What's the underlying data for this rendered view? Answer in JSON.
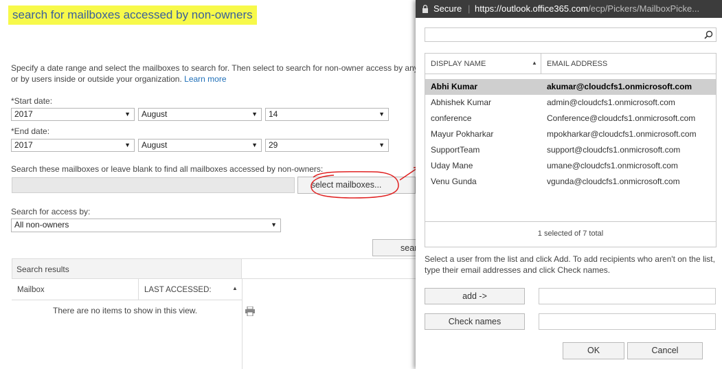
{
  "main": {
    "title": "search for mailboxes accessed by non-owners",
    "instructions_line1": "Specify a date range and select the mailboxes to search for. Then select to search for non-owner access by anyo",
    "instructions_line2": "or by users inside or outside your organization.",
    "learn_more": "Learn more",
    "start_date_label": "*Start date:",
    "start_year": "2017",
    "start_month": "August",
    "start_day": "14",
    "end_date_label": "*End date:",
    "end_year": "2017",
    "end_month": "August",
    "end_day": "29",
    "mailboxes_label": "Search these mailboxes or leave blank to find all mailboxes accessed by non-owners:",
    "select_mailboxes_button": "select mailboxes...",
    "access_by_label": "Search for access by:",
    "access_by_value": "All non-owners",
    "search_button_partial": "sear",
    "results_header": "Search results",
    "col_mailbox": "Mailbox",
    "col_last_accessed": "LAST ACCESSED:",
    "no_items": "There are no items to show in this view."
  },
  "popup": {
    "secure_label": "Secure",
    "url_host": "https://outlook.office365.com",
    "url_path": "/ecp/Pickers/MailboxPicke...",
    "search_placeholder": "",
    "col_display_name": "DISPLAY NAME",
    "col_email": "EMAIL ADDRESS",
    "rows": [
      {
        "name": "Abhi Kumar",
        "email": "akumar@cloudcfs1.onmicrosoft.com",
        "selected": true
      },
      {
        "name": "Abhishek Kumar",
        "email": "admin@cloudcfs1.onmicrosoft.com",
        "selected": false
      },
      {
        "name": "conference",
        "email": "Conference@cloudcfs1.onmicrosoft.com",
        "selected": false
      },
      {
        "name": "Mayur Pokharkar",
        "email": "mpokharkar@cloudcfs1.onmicrosoft.com",
        "selected": false
      },
      {
        "name": "SupportTeam",
        "email": "support@cloudcfs1.onmicrosoft.com",
        "selected": false
      },
      {
        "name": "Uday Mane",
        "email": "umane@cloudcfs1.onmicrosoft.com",
        "selected": false
      },
      {
        "name": "Venu Gunda",
        "email": "vgunda@cloudcfs1.onmicrosoft.com",
        "selected": false
      }
    ],
    "selection_status": "1 selected of 7 total",
    "help_line1": "Select a user from the list and click Add. To add recipients who aren't on the list,",
    "help_line2": "type their email addresses and click Check names.",
    "add_button": "add ->",
    "check_names_button": "Check names",
    "ok_button": "OK",
    "cancel_button": "Cancel"
  },
  "colors": {
    "highlight": "#f7f94a",
    "title_text": "#3a5f9c",
    "link": "#1e6fb8",
    "annotation": "#e02020"
  }
}
